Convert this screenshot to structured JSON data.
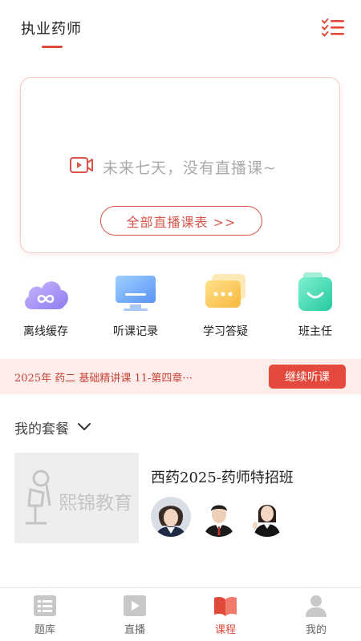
{
  "header": {
    "title": "执业药师",
    "menu_icon": "checklist-menu-icon"
  },
  "live": {
    "empty_text": "未来七天，没有直播课~",
    "schedule_button": "全部直播课表 >>",
    "icon": "live-video-icon"
  },
  "quick_actions": [
    {
      "label": "离线缓存",
      "icon": "cloud-cache-icon"
    },
    {
      "label": "听课记录",
      "icon": "monitor-history-icon"
    },
    {
      "label": "学习答疑",
      "icon": "chat-question-icon"
    },
    {
      "label": "班主任",
      "icon": "class-teacher-icon"
    }
  ],
  "continue": {
    "text": "2025年  药二  基础精讲课  11-第四章···",
    "button": "继续听课"
  },
  "packages": {
    "title": "我的套餐",
    "items": [
      {
        "name": "西药2025-药师特招班",
        "thumb_brand": "熙锦教育",
        "teachers": [
          "teacher-1",
          "teacher-2",
          "teacher-3"
        ]
      }
    ]
  },
  "tabs": [
    {
      "label": "题库",
      "icon": "question-bank-icon",
      "active": false
    },
    {
      "label": "直播",
      "icon": "live-play-icon",
      "active": false
    },
    {
      "label": "课程",
      "icon": "course-book-icon",
      "active": true
    },
    {
      "label": "我的",
      "icon": "profile-icon",
      "active": false
    }
  ],
  "colors": {
    "accent": "#e04a3a",
    "accent_light": "#fdecea"
  }
}
